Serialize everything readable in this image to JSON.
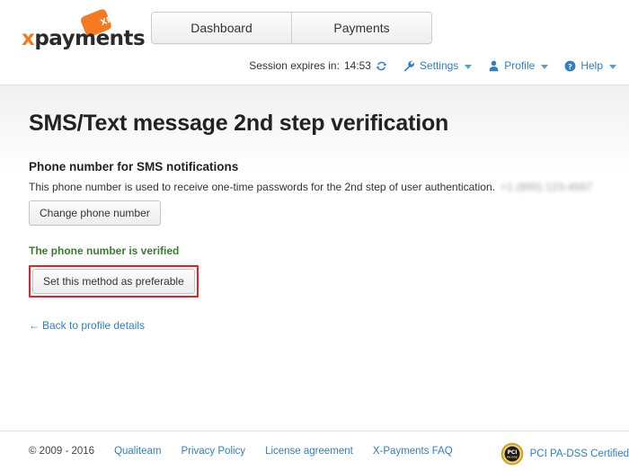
{
  "header": {
    "logo": {
      "word_x": "x",
      "word_rest": "payments",
      "tag_text": "XP",
      "alt": "X-Payments logo"
    },
    "tabs": [
      {
        "label": "Dashboard",
        "name": "tab-dashboard"
      },
      {
        "label": "Payments",
        "name": "tab-payments"
      }
    ],
    "session": {
      "label": "Session expires in:",
      "time": "14:53",
      "refresh_icon": "refresh-icon"
    },
    "menus": [
      {
        "label": "Settings",
        "icon": "wrench-icon"
      },
      {
        "label": "Profile",
        "icon": "user-icon"
      },
      {
        "label": "Help",
        "icon": "help-circle-icon"
      }
    ]
  },
  "main": {
    "page_title": "SMS/Text message 2nd step verification",
    "section_title": "Phone number for SMS notifications",
    "description": "This phone number is used to receive one-time passwords for the 2nd step of user authentication.",
    "phone_number_redacted": "+1 (800) 123-4567",
    "change_phone_button": "Change phone number",
    "verified_status": "The phone number is verified",
    "set_preferable_button": "Set this method as preferable",
    "back_link": "Back to profile details",
    "back_arrow": "←"
  },
  "footer": {
    "copyright": "© 2009 - 2016",
    "links": [
      {
        "label": "Qualiteam"
      },
      {
        "label": "Privacy Policy"
      },
      {
        "label": "License agreement"
      },
      {
        "label": "X-Payments FAQ"
      }
    ],
    "badge": {
      "text": "PCI PA-DSS Certified",
      "seal_top": "PCI",
      "seal_bottom": "PA-DSS"
    }
  },
  "colors": {
    "brand_orange": "#f47920",
    "link_blue": "#2f7fc1",
    "success_green": "#3a7d32",
    "highlight_red": "#ee1c25",
    "seal_gold": "#c9a227"
  }
}
